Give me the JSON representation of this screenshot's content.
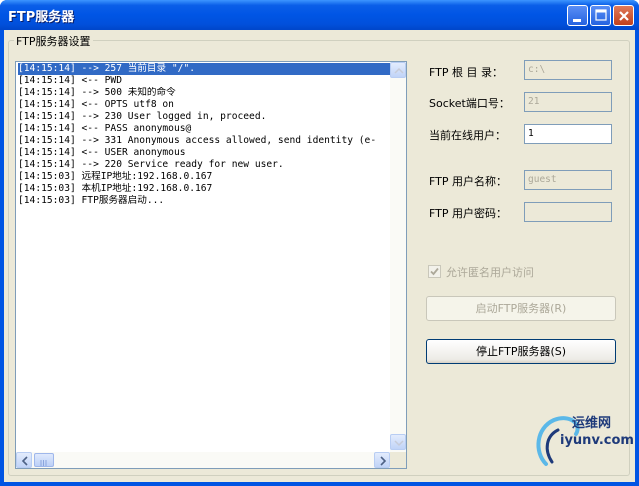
{
  "window": {
    "title": "FTP服务器"
  },
  "group": {
    "caption": "FTP服务器设置"
  },
  "log": {
    "lines": [
      "[14:15:14] --> 257 当前目录 \"/\".",
      "[14:15:14] <-- PWD",
      "[14:15:14] --> 500 未知的命令",
      "[14:15:14] <-- OPTS utf8 on",
      "[14:15:14] --> 230 User logged in, proceed.",
      "[14:15:14] <-- PASS anonymous@",
      "[14:15:14] --> 331 Anonymous access allowed, send identity (e-",
      "[14:15:14] <-- USER anonymous",
      "[14:15:14] --> 220 Service ready for new user.",
      "[14:15:03] 远程IP地址:192.168.0.167",
      "[14:15:03] 本机IP地址:192.168.0.167",
      "[14:15:03] FTP服务器启动..."
    ],
    "selected_index": 0
  },
  "settings": {
    "root_dir_label": "FTP 根 目 录：",
    "root_dir_value": "c:\\",
    "port_label": "Socket端口号：",
    "port_value": "21",
    "online_label": "当前在线用户：",
    "online_value": "1",
    "username_label": "FTP 用户名称：",
    "username_value": "guest",
    "password_label": "FTP 用户密码：",
    "password_value": "",
    "anon_label": "允许匿名用户访问",
    "anon_checked": true
  },
  "buttons": {
    "start": "启动FTP服务器(R)",
    "stop": "停止FTP服务器(S)"
  },
  "watermark": {
    "line1": "运维网",
    "line2": "iyunv.com"
  },
  "colors": {
    "title_bar": "#0054e3",
    "selection": "#316ac5",
    "dialog_bg": "#ece9d8"
  }
}
